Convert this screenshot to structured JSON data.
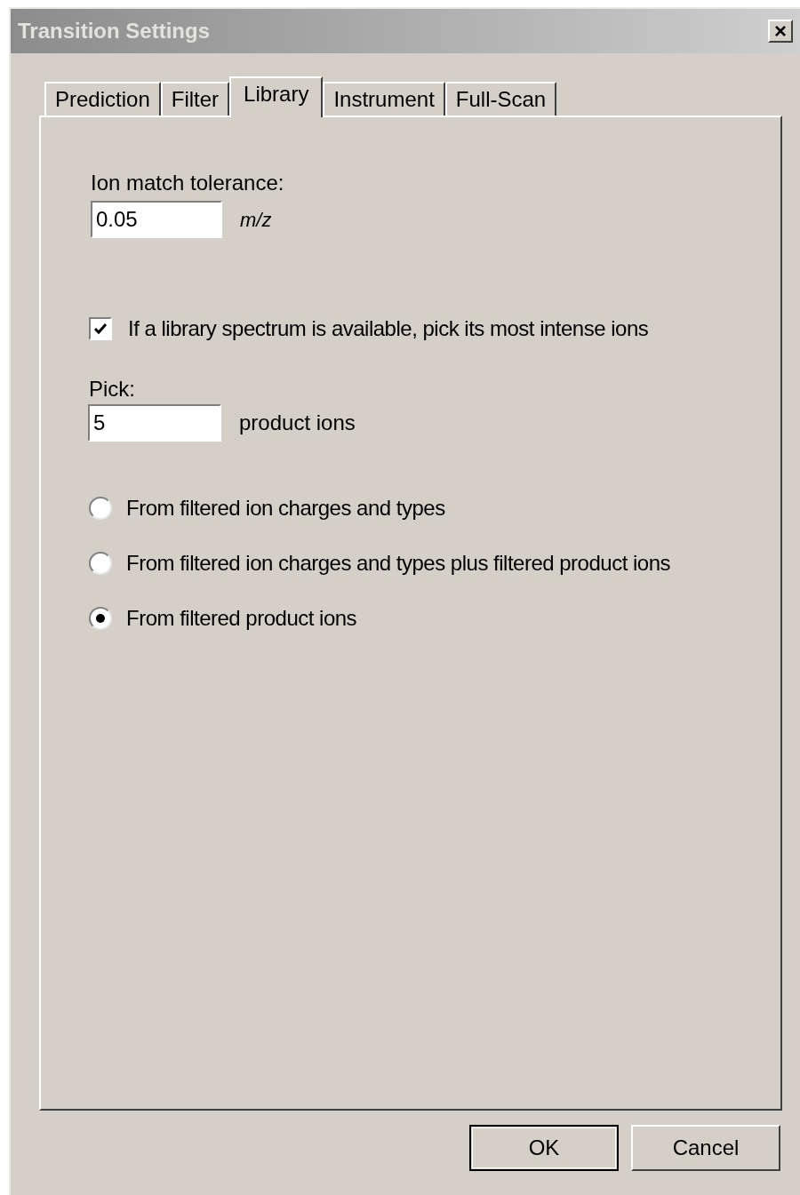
{
  "window": {
    "title": "Transition Settings",
    "close": "×"
  },
  "tabs": [
    {
      "label": "Prediction",
      "selected": false
    },
    {
      "label": "Filter",
      "selected": false
    },
    {
      "label": "Library",
      "selected": true
    },
    {
      "label": "Instrument",
      "selected": false
    },
    {
      "label": "Full-Scan",
      "selected": false
    }
  ],
  "tolerance": {
    "label": "Ion match tolerance:",
    "value": "0.05",
    "unit": "m/z"
  },
  "library_checkbox": {
    "label": "If a library spectrum is available, pick its most intense ions",
    "checked": true
  },
  "pick": {
    "label": "Pick:",
    "value": "5",
    "unit": "product ions"
  },
  "options": [
    {
      "label": "From filtered ion charges and types",
      "selected": false
    },
    {
      "label": "From filtered ion charges and types plus filtered product ions",
      "selected": false
    },
    {
      "label": "From filtered product ions",
      "selected": true
    }
  ],
  "buttons": [
    {
      "label": "OK",
      "default": true
    },
    {
      "label": "Cancel",
      "default": false
    }
  ]
}
